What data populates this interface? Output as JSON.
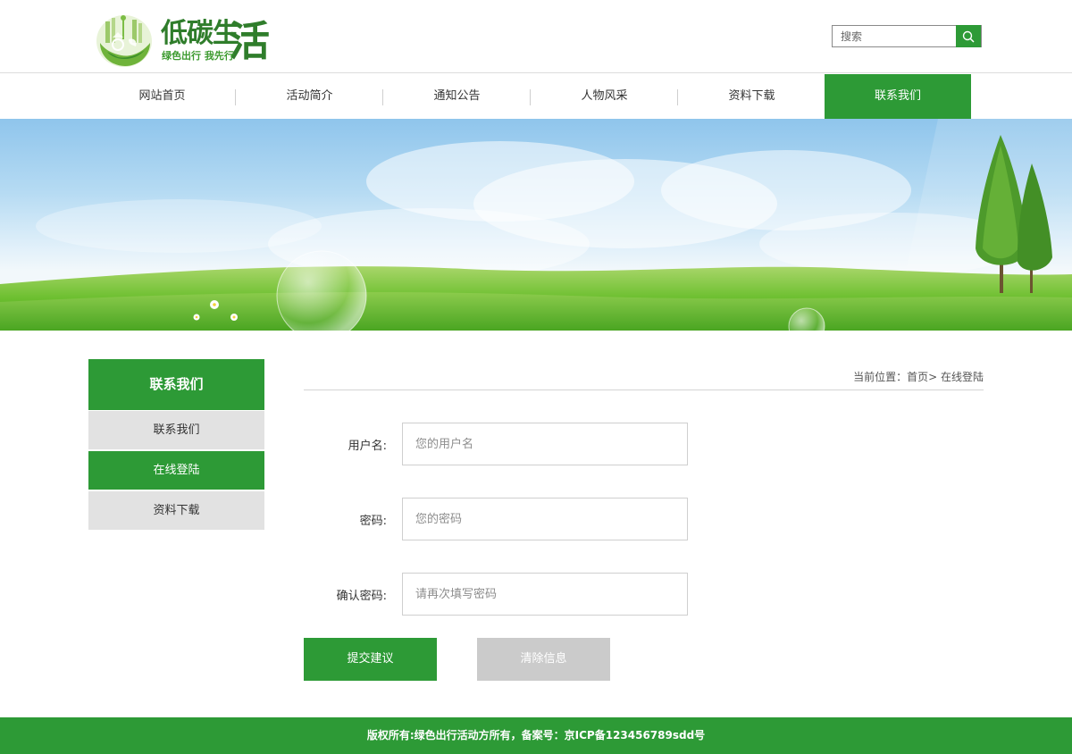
{
  "header": {
    "logo": {
      "title": "低碳生",
      "title_big": "活",
      "subtitle": "绿色出行 我先行"
    },
    "search": {
      "placeholder": "搜索",
      "icon": "search-icon"
    }
  },
  "nav": {
    "items": [
      {
        "label": "网站首页",
        "active": false
      },
      {
        "label": "活动简介",
        "active": false
      },
      {
        "label": "通知公告",
        "active": false
      },
      {
        "label": "人物风采",
        "active": false
      },
      {
        "label": "资料下载",
        "active": false
      },
      {
        "label": "联系我们",
        "active": true
      }
    ]
  },
  "sidebar": {
    "title": "联系我们",
    "items": [
      {
        "label": "联系我们",
        "active": false
      },
      {
        "label": "在线登陆",
        "active": true
      },
      {
        "label": "资料下载",
        "active": false
      }
    ]
  },
  "breadcrumb": {
    "prefix": "当前位置：",
    "home": "首页",
    "separator": "> ",
    "current": "在线登陆"
  },
  "form": {
    "username": {
      "label": "用户名:",
      "placeholder": "您的用户名",
      "value": ""
    },
    "password": {
      "label": "密码:",
      "placeholder": "您的密码",
      "value": ""
    },
    "confirm": {
      "label": "确认密码:",
      "placeholder": "请再次填写密码",
      "value": ""
    },
    "submit_label": "提交建议",
    "clear_label": "清除信息"
  },
  "footer": {
    "text": "版权所有:绿色出行活动方所有，备案号：京ICP备123456789sdd号"
  },
  "colors": {
    "brand_green": "#2d9a36",
    "sidebar_inactive": "#e2e2e2",
    "clear_button": "#cbcbcb"
  }
}
